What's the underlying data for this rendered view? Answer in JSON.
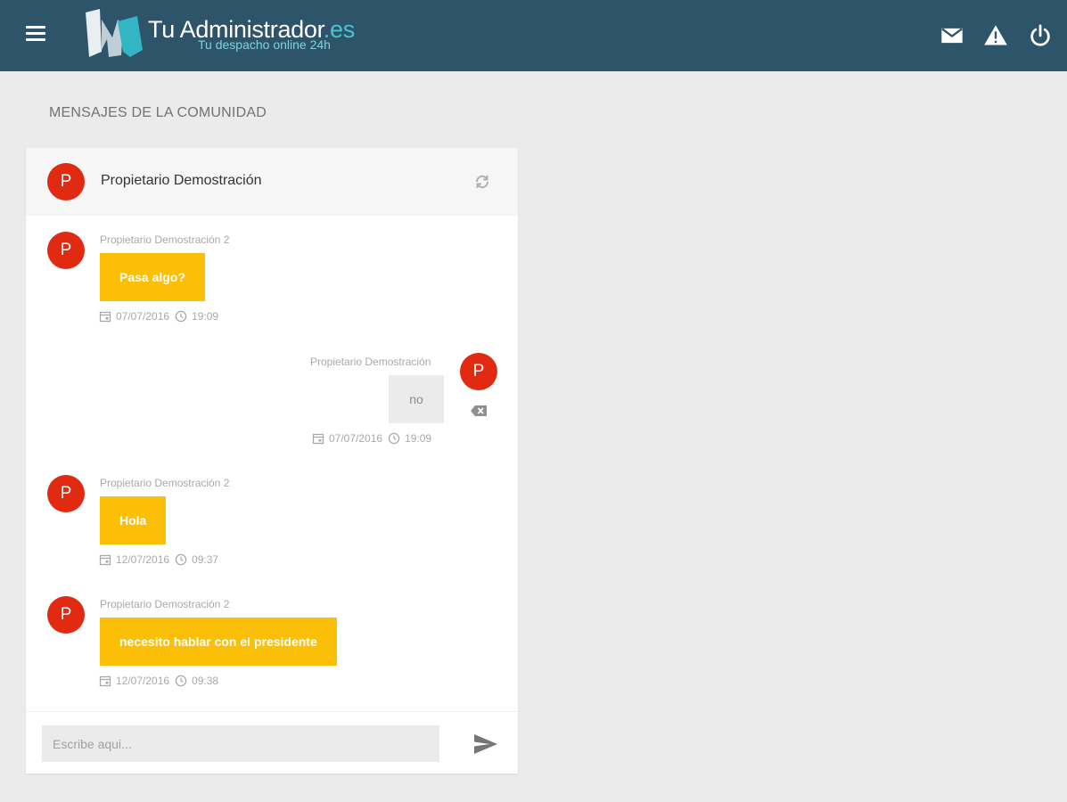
{
  "header": {
    "brand_name": "Tu Administrador",
    "brand_suffix": ".es",
    "tagline": "Tu despacho online 24h",
    "icons": [
      "menu-icon",
      "mail-icon",
      "warning-icon",
      "power-icon"
    ],
    "color": "#2d5468"
  },
  "page": {
    "title": "MENSAJES DE LA COMUNIDAD"
  },
  "chat": {
    "header_avatar": "P",
    "header_name": "Propietario Demostración",
    "messages": [
      {
        "direction": "incoming",
        "avatar": "P",
        "sender": "Propietario Demostración 2",
        "text": "Pasa algo?",
        "date": "07/07/2016",
        "time": "19:09"
      },
      {
        "direction": "outgoing",
        "avatar": "P",
        "sender": "Propietario Demostración",
        "text": "no",
        "date": "07/07/2016",
        "time": "19:09"
      },
      {
        "direction": "incoming",
        "avatar": "P",
        "sender": "Propietario Demostración 2",
        "text": "Hola",
        "date": "12/07/2016",
        "time": "09:37"
      },
      {
        "direction": "incoming",
        "avatar": "P",
        "sender": "Propietario Demostración 2",
        "text": "necesito hablar con el presidente",
        "date": "12/07/2016",
        "time": "09:38"
      }
    ],
    "composer": {
      "placeholder": "Escribe aqui..."
    }
  },
  "colors": {
    "avatar": "#e02a11",
    "incoming_bubble": "#fcbf07",
    "outgoing_bubble": "#ebebeb",
    "background": "#ebebeb"
  }
}
